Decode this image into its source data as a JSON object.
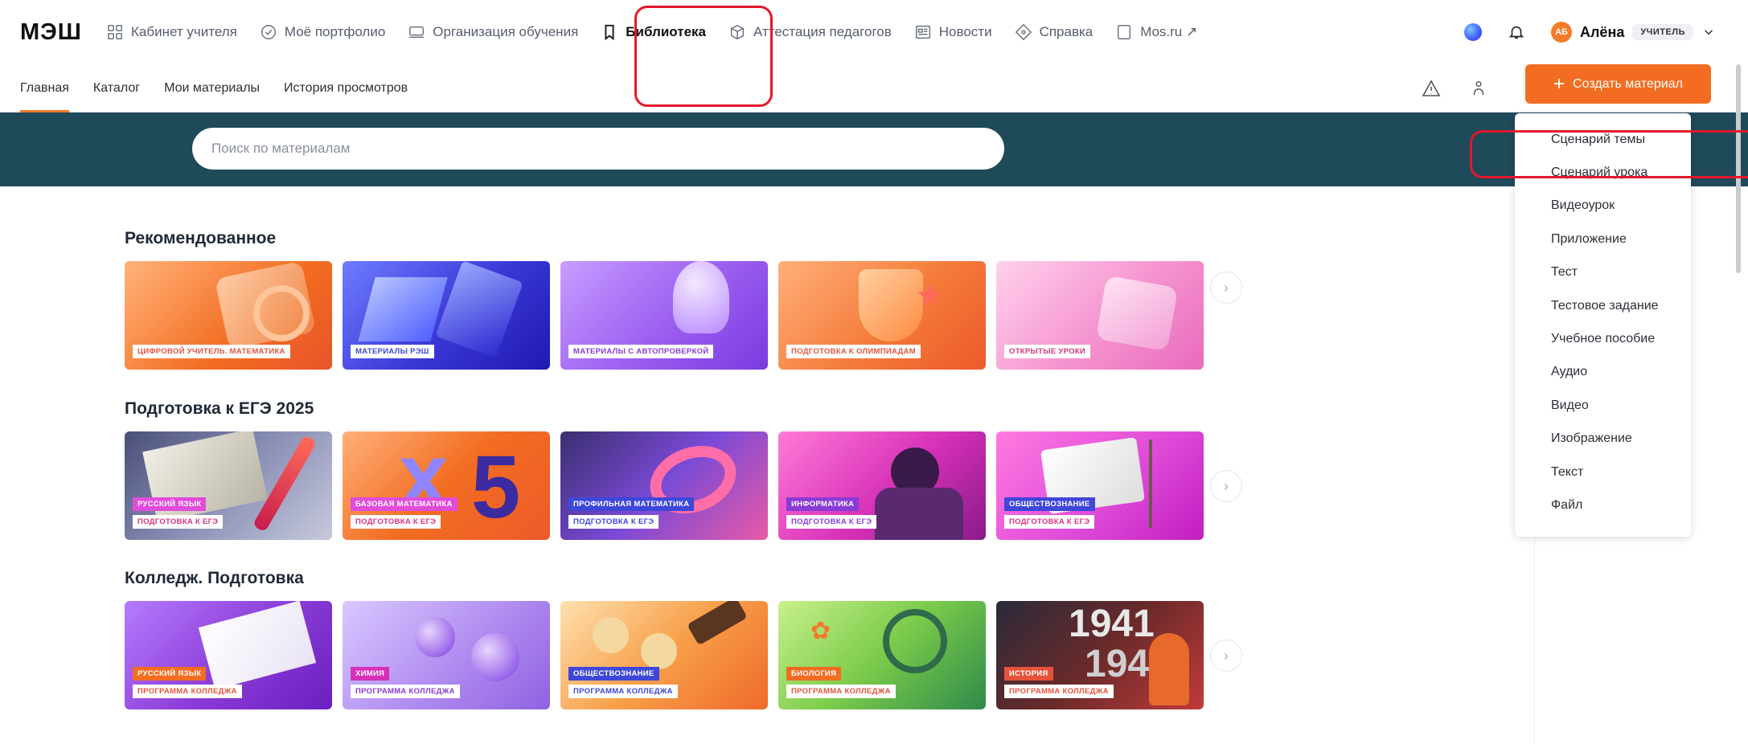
{
  "logo": "МЭШ",
  "nav": [
    {
      "label": "Кабинет учителя",
      "icon": "grid-icon"
    },
    {
      "label": "Моё портфолио",
      "icon": "check-circle-icon"
    },
    {
      "label": "Организация обучения",
      "icon": "monitor-icon"
    },
    {
      "label": "Библиотека",
      "icon": "bookmark-icon",
      "active": true
    },
    {
      "label": "Аттестация педагогов",
      "icon": "cube-icon"
    },
    {
      "label": "Новости",
      "icon": "news-icon"
    },
    {
      "label": "Справка",
      "icon": "help-diamond-icon"
    },
    {
      "label": "Mos.ru ↗",
      "icon": "tablet-icon"
    }
  ],
  "user": {
    "initials": "АБ",
    "name": "Алёна",
    "role": "УЧИТЕЛЬ"
  },
  "subnav": {
    "tabs": [
      "Главная",
      "Каталог",
      "Мои материалы",
      "История просмотров"
    ],
    "active": "Главная"
  },
  "create_button": "Создать материал",
  "search": {
    "placeholder": "Поиск по материалам"
  },
  "sections": [
    {
      "title": "Рекомендованное",
      "cards": [
        {
          "tags": [
            "ЦИФРОВОЙ УЧИТЕЛЬ. МАТЕМАТИКА"
          ]
        },
        {
          "tags": [
            "МАТЕРИАЛЫ РЭШ"
          ]
        },
        {
          "tags": [
            "МАТЕРИАЛЫ С АВТОПРОВЕРКОЙ"
          ]
        },
        {
          "tags": [
            "ПОДГОТОВКА К ОЛИМПИАДАМ"
          ]
        },
        {
          "tags": [
            "ОТКРЫТЫЕ УРОКИ"
          ]
        }
      ]
    },
    {
      "title": "Подготовка к ЕГЭ 2025",
      "cards": [
        {
          "tags": [
            "РУССКИЙ ЯЗЫК",
            "ПОДГОТОВКА К ЕГЭ"
          ]
        },
        {
          "tags": [
            "БАЗОВАЯ МАТЕМАТИКА",
            "ПОДГОТОВКА К ЕГЭ"
          ]
        },
        {
          "tags": [
            "ПРОФИЛЬНАЯ МАТЕМАТИКА",
            "ПОДГОТОВКА К ЕГЭ"
          ]
        },
        {
          "tags": [
            "ИНФОРМАТИКА",
            "ПОДГОТОВКА К ЕГЭ"
          ]
        },
        {
          "tags": [
            "ОБЩЕСТВОЗНАНИЕ",
            "ПОДГОТОВКА К ЕГЭ"
          ]
        }
      ]
    },
    {
      "title": "Колледж. Подготовка",
      "cards": [
        {
          "tags": [
            "РУССКИЙ ЯЗЫК",
            "ПРОГРАММА КОЛЛЕДЖА"
          ]
        },
        {
          "tags": [
            "ХИМИЯ",
            "ПРОГРАММА КОЛЛЕДЖА"
          ]
        },
        {
          "tags": [
            "ОБЩЕСТВОЗНАНИЕ",
            "ПРОГРАММА КОЛЛЕДЖА"
          ]
        },
        {
          "tags": [
            "БИОЛОГИЯ",
            "ПРОГРАММА КОЛЛЕДЖА"
          ]
        },
        {
          "tags": [
            "ИСТОРИЯ",
            "ПРОГРАММА КОЛЛЕДЖА"
          ]
        }
      ]
    }
  ],
  "dropdown": [
    "Сценарий темы",
    "Сценарий урока",
    "Видеоурок",
    "Приложение",
    "Тест",
    "Тестовое задание",
    "Учебное пособие",
    "Аудио",
    "Видео",
    "Изображение",
    "Текст",
    "Файл"
  ],
  "colors": {
    "accent": "#f26d21",
    "band": "#1f4a5a",
    "highlight": "#e3182d"
  }
}
